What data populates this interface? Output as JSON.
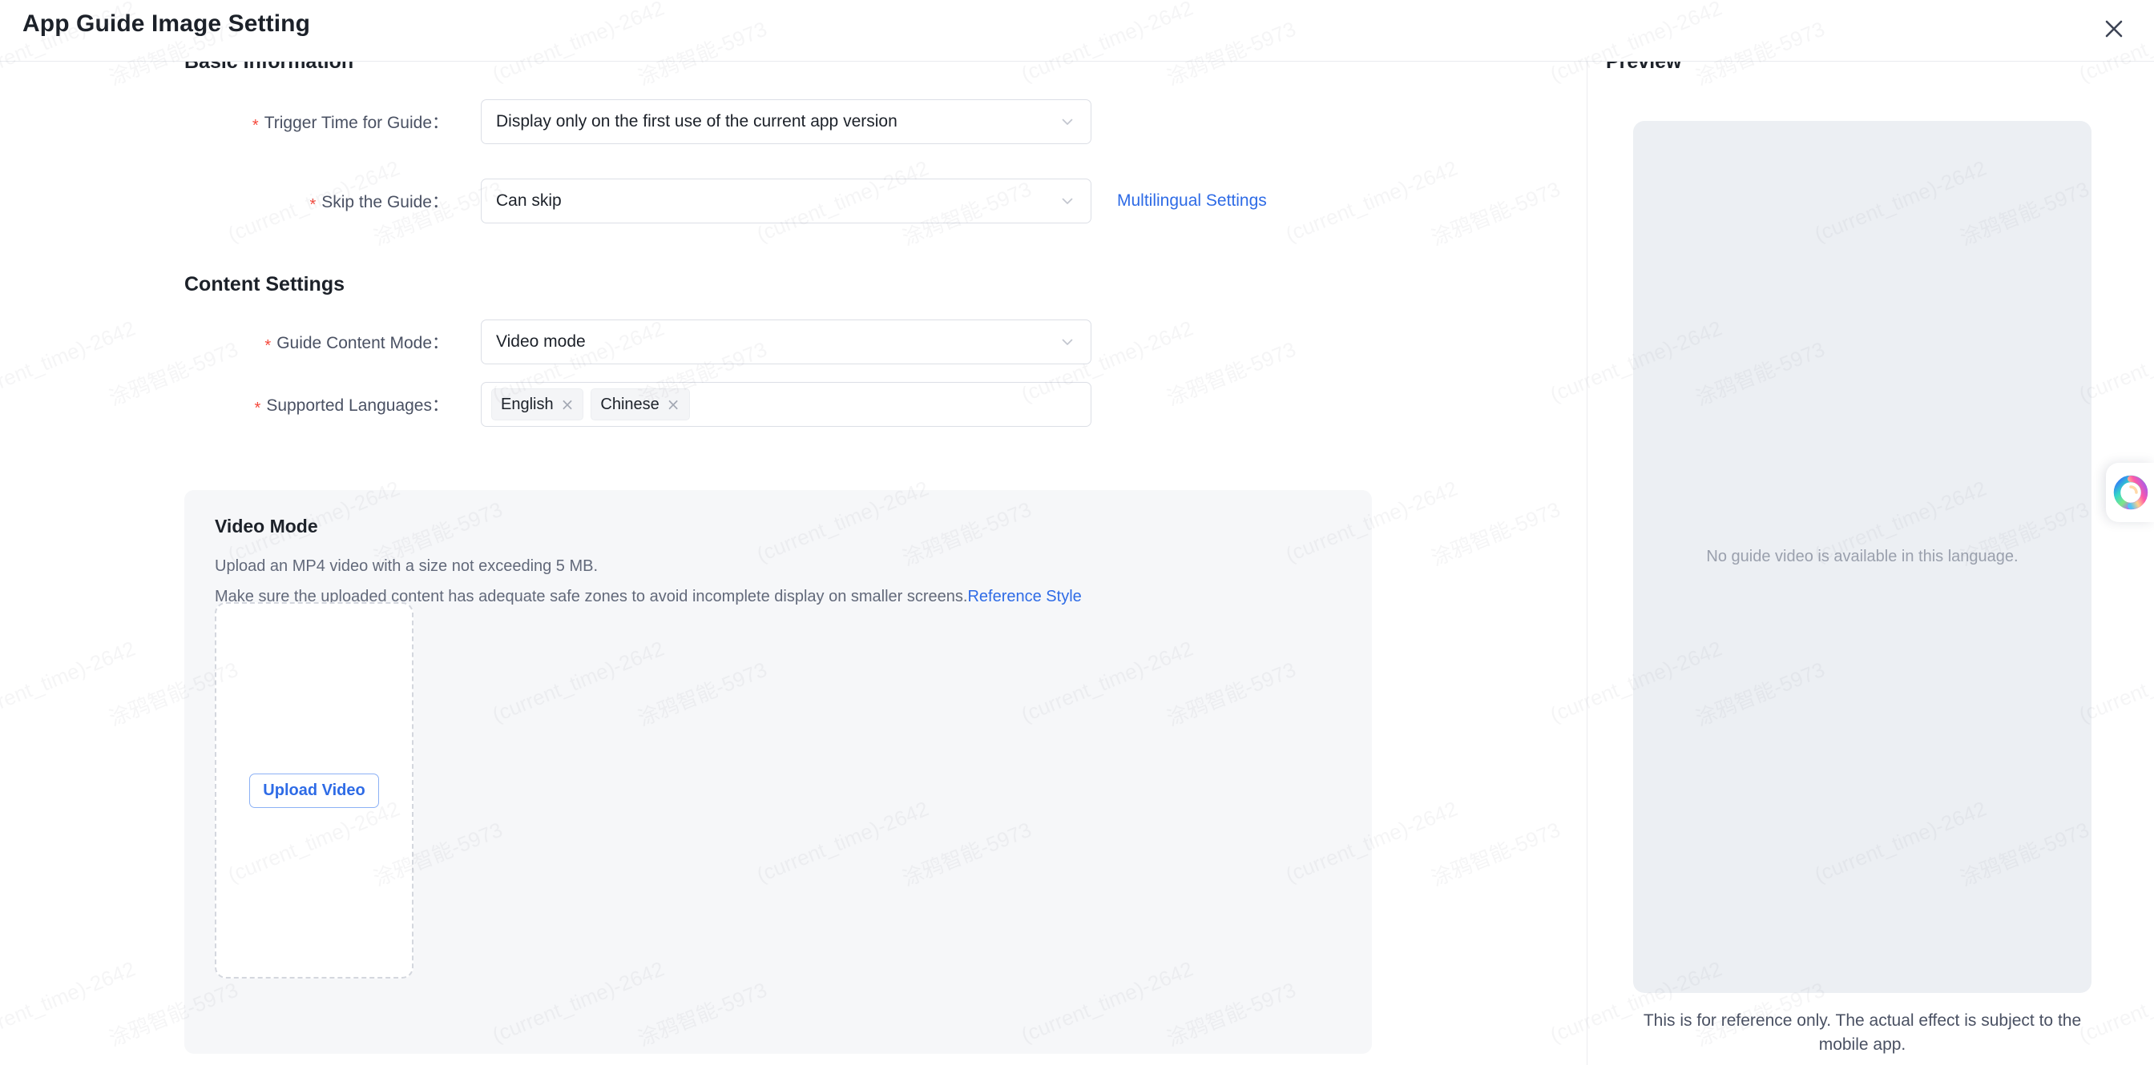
{
  "header": {
    "title": "App Guide Image Setting",
    "close_icon": "close-icon"
  },
  "form": {
    "basic_section_title": "Basic Information",
    "content_section_title": "Content Settings",
    "rows": [
      {
        "label": "Trigger Time for Guide：",
        "required": true,
        "value": "Display only on the first use of the current app version",
        "control": "select"
      },
      {
        "label": "Skip the Guide：",
        "required": true,
        "value": "Can skip",
        "control": "select",
        "side_link": "Multilingual Settings"
      },
      {
        "label": "Guide Content Mode：",
        "required": true,
        "value": "Video mode",
        "control": "select"
      },
      {
        "label": "Supported Languages：",
        "required": true,
        "control": "tags",
        "tags": [
          "English",
          "Chinese"
        ],
        "tag_close_glyph": "×"
      }
    ]
  },
  "video_mode": {
    "title": "Video Mode",
    "line1": "Upload an MP4 video with a size not exceeding 5 MB.",
    "line2": "Make sure the uploaded content has adequate safe zones to avoid incomplete display on smaller screens.",
    "line2_link": "Reference Style",
    "upload_button": "Upload Video"
  },
  "preview": {
    "title": "Preview",
    "empty_text": "No guide video is available in this language.",
    "note": "This is for reference only. The actual effect is subject to the mobile app."
  },
  "assistant": {
    "icon": "ai-assistant-icon"
  },
  "colors": {
    "accent_blue": "#2e6be6",
    "required_red": "#f5483b",
    "panel_gray": "#f6f7f9",
    "preview_gray": "#eceff3"
  },
  "watermark": {
    "text_a": "涂鸦智能-5973",
    "text_b": "(current_time)-2642"
  }
}
